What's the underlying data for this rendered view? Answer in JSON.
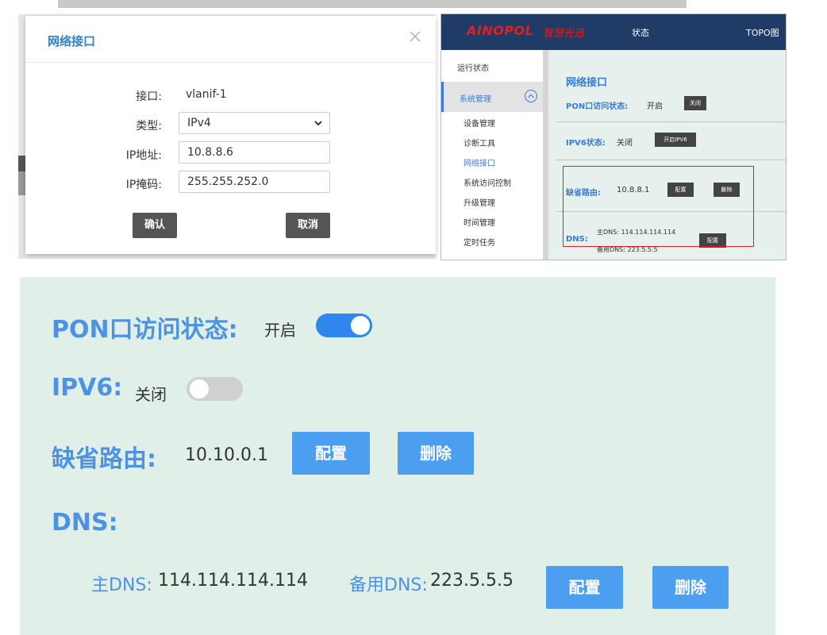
{
  "dialog": {
    "title": "网络接口",
    "interface_label": "接口:",
    "interface_value": "vlanif-1",
    "type_label": "类型:",
    "type_value": "IPv4",
    "ip_label": "IP地址:",
    "ip_value": "10.8.8.6",
    "mask_label": "IP掩码:",
    "mask_value": "255.255.252.0",
    "confirm_label": "确认",
    "cancel_label": "取消"
  },
  "router": {
    "brand": "AINOPOL",
    "brand_cn": "智慧光迅",
    "nav": {
      "status": "状态",
      "topo": "TOPO图"
    },
    "sidebar": {
      "run_status": "运行状态",
      "system_mgmt": "系统管理",
      "items": [
        "设备管理",
        "诊断工具",
        "网络接口",
        "系统访问控制",
        "升级管理",
        "时间管理",
        "定时任务"
      ]
    },
    "content": {
      "title": "网络接口",
      "pon_label": "PON口访问状态:",
      "pon_value": "开启",
      "pon_button": "关闭",
      "ipv6_label": "IPV6状态:",
      "ipv6_value": "关闭",
      "ipv6_button": "开启IPV6",
      "route_label": "缺省路由:",
      "route_value": "10.8.8.1",
      "route_config": "配置",
      "route_delete": "删除",
      "dns_label": "DNS:",
      "dns_primary": "主DNS: 114.114.114.114",
      "dns_backup": "备用DNS: 223.5.5.5",
      "dns_config": "配置"
    }
  },
  "zoom": {
    "pon_label": "PON口访问状态:",
    "pon_value": "开启",
    "pon_toggle_on": true,
    "ipv6_label": "IPV6:",
    "ipv6_value": "关闭",
    "ipv6_toggle_on": false,
    "route_label": "缺省路由:",
    "route_value": "10.10.0.1",
    "route_config": "配置",
    "route_delete": "删除",
    "dns_label": "DNS:",
    "dns_primary_label": "主DNS:",
    "dns_primary_value": "114.114.114.114",
    "dns_backup_label": "备用DNS:",
    "dns_backup_value": "223.5.5.5",
    "dns_config": "配置",
    "dns_delete": "删除"
  },
  "colors": {
    "accent_blue": "#4b9ef0",
    "label_blue": "#4c93e6",
    "toggle_on": "#2f86ee",
    "toggle_off": "#d0d0d0",
    "header_navy": "#213b67",
    "highlight_red": "#e02020"
  }
}
